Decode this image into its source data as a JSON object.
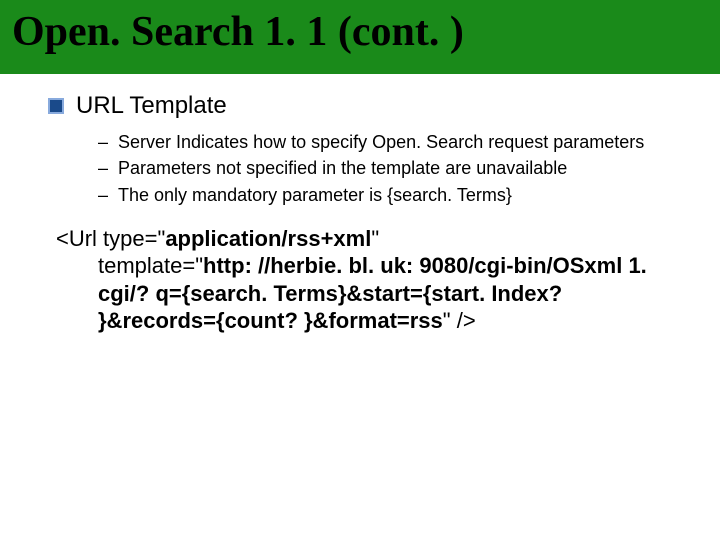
{
  "header": {
    "title": "Open. Search 1. 1 (cont. )"
  },
  "section": {
    "title": "URL Template",
    "items": [
      "Server Indicates how to specify Open. Search request parameters",
      "Parameters not specified in the template are unavailable",
      "The only mandatory parameter is {search. Terms}"
    ]
  },
  "code": {
    "line1_pre": "<Url type=\"",
    "line1_bold": "application/rss+xml",
    "line1_post": "\"",
    "line2_pre": "template=\"",
    "line2_bold": "http: //herbie. bl. uk: 9080/cgi-bin/OSxml 1. cgi/? q={search. Terms}&start={start. Index? }&records={count? }&format=rss",
    "line2_post": "\" />"
  }
}
